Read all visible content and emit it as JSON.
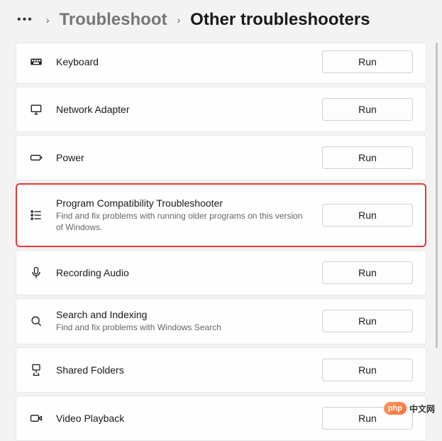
{
  "breadcrumb": {
    "more": "•••",
    "prev": "Troubleshoot",
    "current": "Other troubleshooters"
  },
  "run_label": "Run",
  "items": [
    {
      "title": "Keyboard",
      "desc": "",
      "highlighted": false
    },
    {
      "title": "Network Adapter",
      "desc": "",
      "highlighted": false
    },
    {
      "title": "Power",
      "desc": "",
      "highlighted": false
    },
    {
      "title": "Program Compatibility Troubleshooter",
      "desc": "Find and fix problems with running older programs on this version of Windows.",
      "highlighted": true
    },
    {
      "title": "Recording Audio",
      "desc": "",
      "highlighted": false
    },
    {
      "title": "Search and Indexing",
      "desc": "Find and fix problems with Windows Search",
      "highlighted": false
    },
    {
      "title": "Shared Folders",
      "desc": "",
      "highlighted": false
    },
    {
      "title": "Video Playback",
      "desc": "",
      "highlighted": false
    }
  ],
  "watermark": {
    "badge": "php",
    "text": "中文网"
  }
}
